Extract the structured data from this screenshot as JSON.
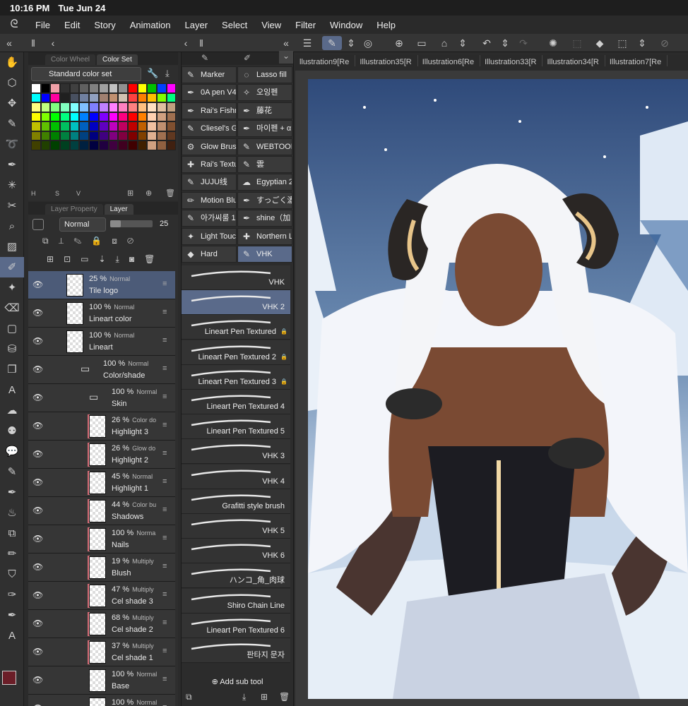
{
  "status": {
    "time": "10:16 PM",
    "date": "Tue Jun 24"
  },
  "menu": [
    "File",
    "Edit",
    "Story",
    "Animation",
    "Layer",
    "Select",
    "View",
    "Filter",
    "Window",
    "Help"
  ],
  "color_panel": {
    "tabs": [
      "Color Wheel",
      "Color Set"
    ],
    "active_tab": "Color Set",
    "selected_set": "Standard color set",
    "bottom_labels": [
      "H",
      "S",
      "V"
    ]
  },
  "layer_panel": {
    "tabs": [
      "Layer Property",
      "Layer"
    ],
    "blend_mode": "Normal",
    "opacity": "25",
    "layers": [
      {
        "pct": "25 %",
        "mode": "Normal",
        "name": "Tile logo",
        "selected": true
      },
      {
        "pct": "100 %",
        "mode": "Normal",
        "name": "Lineart color"
      },
      {
        "pct": "100 %",
        "mode": "Normal",
        "name": "Lineart"
      },
      {
        "pct": "100 %",
        "mode": "Normal",
        "name": "Color/shade",
        "folder": true
      },
      {
        "pct": "100 %",
        "mode": "Normal",
        "name": "Skin",
        "folder": true
      },
      {
        "pct": "26 %",
        "mode": "Color do",
        "name": "Highlight 3"
      },
      {
        "pct": "26 %",
        "mode": "Glow do",
        "name": "Highlight 2"
      },
      {
        "pct": "45 %",
        "mode": "Normal",
        "name": "Highlight 1"
      },
      {
        "pct": "44 %",
        "mode": "Color bu",
        "name": "Shadows"
      },
      {
        "pct": "100 %",
        "mode": "Norma",
        "name": "Nails"
      },
      {
        "pct": "19 %",
        "mode": "Multiply",
        "name": "Blush"
      },
      {
        "pct": "47 %",
        "mode": "Multiply",
        "name": "Cel shade 3"
      },
      {
        "pct": "68 %",
        "mode": "Multiply",
        "name": "Cel shade 2"
      },
      {
        "pct": "37 %",
        "mode": "Multiply",
        "name": "Cel shade 1"
      },
      {
        "pct": "100 %",
        "mode": "Normal",
        "name": "Base"
      },
      {
        "pct": "100 %",
        "mode": "Normal",
        "name": ""
      }
    ]
  },
  "subtools": [
    [
      "Marker",
      "Lasso fill"
    ],
    [
      "0A pen V4",
      "오잉펜"
    ],
    [
      "Rai's Fishn",
      "藤花"
    ],
    [
      "Cliesel's G",
      "마이펜 + α"
    ],
    [
      "Glow Brus",
      "WEBTOON"
    ],
    [
      "Rai's Textu",
      "雲"
    ],
    [
      "JUJU线",
      "Egyptian 2"
    ],
    [
      "Motion Blu",
      "すっごく濃"
    ],
    [
      "아가씨룰 1",
      "shine（加"
    ],
    [
      "Light Touc",
      "Northern L"
    ],
    [
      "Hard",
      "VHK"
    ]
  ],
  "brushes": [
    {
      "name": "VHK",
      "locked": false
    },
    {
      "name": "VHK 2",
      "locked": false,
      "selected": true
    },
    {
      "name": "Lineart Pen Textured",
      "locked": true
    },
    {
      "name": "Lineart Pen Textured 2",
      "locked": true
    },
    {
      "name": "Lineart Pen Textured 3",
      "locked": true
    },
    {
      "name": "Lineart Pen Textured 4",
      "locked": false
    },
    {
      "name": "Lineart Pen Textured 5",
      "locked": false
    },
    {
      "name": "VHK 3",
      "locked": false
    },
    {
      "name": "VHK 4",
      "locked": false
    },
    {
      "name": "Grafitti style brush",
      "locked": false
    },
    {
      "name": "VHK 5",
      "locked": false
    },
    {
      "name": "VHK 6",
      "locked": false
    },
    {
      "name": "ハンコ_角_肉球",
      "locked": false
    },
    {
      "name": "Shiro Chain Line",
      "locked": false
    },
    {
      "name": "Lineart Pen Textured 6",
      "locked": false
    },
    {
      "name": "판타지 문자",
      "locked": false
    }
  ],
  "add_sub_tool": "Add sub tool",
  "doc_tabs": [
    "llustration9[Re",
    "Illustration35[R",
    "Illustration6[Re",
    "Illustration33[R",
    "Illustration34[R",
    "Illustration7[Re"
  ],
  "colors": {
    "accent": "#5a6a8a",
    "panel": "#2e2e2e",
    "layer_mark": "#d8707a"
  }
}
